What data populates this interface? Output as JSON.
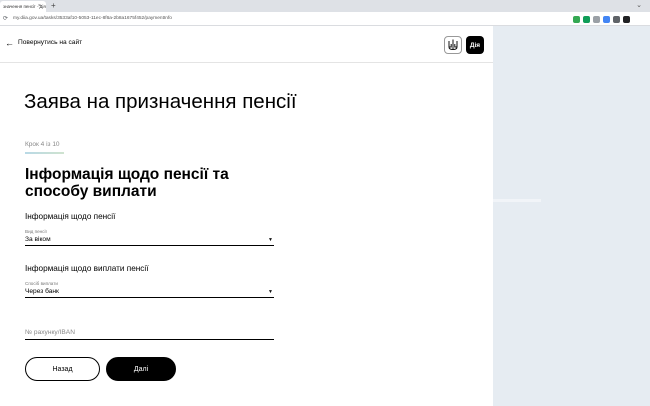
{
  "browser": {
    "tab_title": "значення пенсії · Дія",
    "tab_close": "×",
    "new_tab": "+",
    "window_control": "⌄",
    "url": "my.diia.gov.ua/tasks/3533af10-5053-11ec-8f6a-2b8a1675f452/paymentInfo",
    "back": "←",
    "forward": "→",
    "reload": "⟳"
  },
  "header": {
    "back_arrow": "←",
    "back_label": "Повернутись на сайт",
    "trident_icon": "⚜",
    "diia_logo": "Дія"
  },
  "page": {
    "title": "Заява на призначення пенсії",
    "step": "Крок 4 із 10",
    "section_title": "Інформація щодо пенсії та способу виплати"
  },
  "pension_info": {
    "title": "Інформація щодо пенсії",
    "type_label": "Вид пенсії",
    "type_value": "За віком"
  },
  "payment_info": {
    "title": "Інформація щодо виплати пенсії",
    "method_label": "Спосіб виплати",
    "method_value": "Через банк",
    "iban_placeholder": "№ рахунку/IBAN",
    "iban_value": ""
  },
  "caret": "▼",
  "buttons": {
    "back": "Назад",
    "next": "Далі"
  },
  "colors": {
    "ext_1": "#34a853",
    "ext_2": "#0f9d58",
    "ext_3": "#9aa0a6",
    "ext_4": "#4285f4",
    "ext_5": "#5f6368",
    "ext_6": "#202124"
  }
}
